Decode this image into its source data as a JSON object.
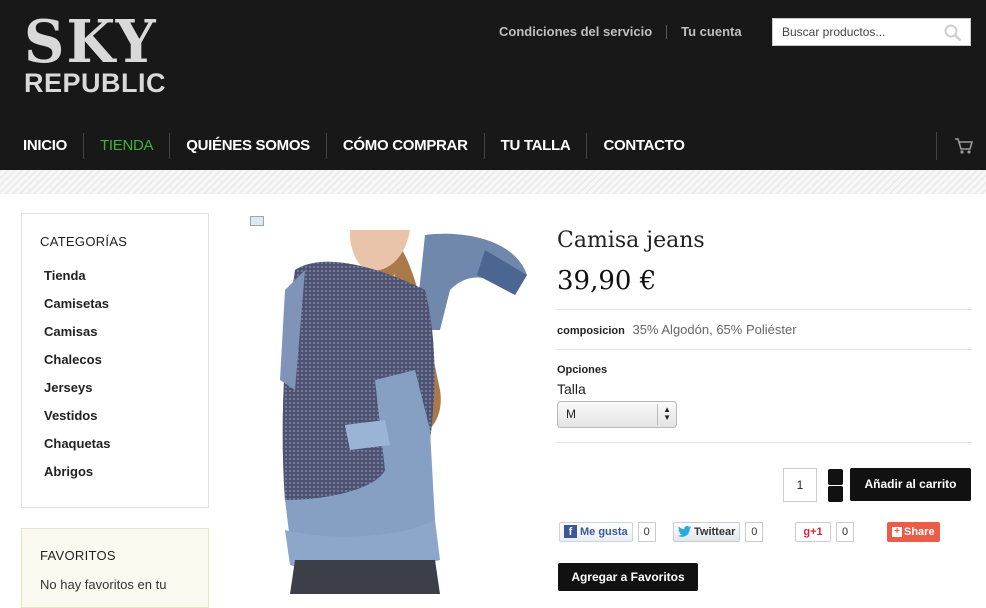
{
  "logo": {
    "line1": "SKY",
    "line2": "REPUBLIC"
  },
  "top_links": [
    "Condiciones del servicio",
    "Tu cuenta"
  ],
  "search": {
    "placeholder": "Buscar productos..."
  },
  "nav": [
    {
      "label": "INICIO",
      "active": false
    },
    {
      "label": "TIENDA",
      "active": true
    },
    {
      "label": "QUIÉNES SOMOS",
      "active": false
    },
    {
      "label": "CÓMO COMPRAR",
      "active": false
    },
    {
      "label": "TU TALLA",
      "active": false
    },
    {
      "label": "CONTACTO",
      "active": false
    }
  ],
  "sidebar": {
    "categories_title": "CATEGORÍAS",
    "categories": [
      "Tienda",
      "Camisetas",
      "Camisas",
      "Chalecos",
      "Jerseys",
      "Vestidos",
      "Chaquetas",
      "Abrigos"
    ],
    "favorites_title": "FAVORITOS",
    "favorites_text": "No hay favoritos en tu"
  },
  "product": {
    "title": "Camisa jeans",
    "price": "39,90 €",
    "composition_label": "composicion",
    "composition_value": "35% Algodón, 65% Poliéster",
    "options_label": "Opciones",
    "size_label": "Talla",
    "size_value": "M",
    "quantity": "1",
    "add_to_cart": "Añadir al carrito",
    "add_to_favorites": "Agregar a Favoritos"
  },
  "social": {
    "facebook_label": "Me gusta",
    "facebook_count": "0",
    "twitter_label": "Twittear",
    "twitter_count": "0",
    "gplus_label": "+1",
    "gplus_count": "0",
    "share_label": "Share"
  },
  "colors": {
    "header_bg": "#181818",
    "nav_active": "#3bb33b",
    "button_bg": "#111111",
    "share_bg": "#eb5d47"
  },
  "icons": [
    "search-icon",
    "cart-icon",
    "facebook-icon",
    "twitter-icon",
    "google-plus-icon",
    "share-icon"
  ]
}
